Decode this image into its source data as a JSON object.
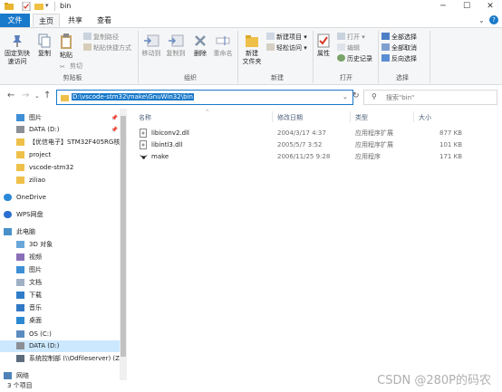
{
  "window": {
    "title": "bin"
  },
  "tabs": [
    "文件",
    "主页",
    "共享",
    "查看"
  ],
  "ribbon": {
    "clipboard": {
      "label": "剪贴板",
      "pin": "固定到快\n速访问",
      "copy": "复制",
      "paste": "粘贴",
      "copy_path": "复制路径",
      "paste_shortcut": "粘贴快捷方式",
      "cut": "剪切"
    },
    "organize": {
      "label": "组织",
      "move_to": "移动到",
      "copy_to": "复制到",
      "delete": "删除",
      "rename": "重命名"
    },
    "new": {
      "label": "新建",
      "new_folder": "新建\n文件夹",
      "new_item": "新建项目",
      "easy_access": "轻松访问"
    },
    "open": {
      "label": "打开",
      "properties": "属性",
      "open": "打开",
      "edit": "编辑",
      "history": "历史记录"
    },
    "select": {
      "label": "选择",
      "select_all": "全部选择",
      "select_none": "全部取消",
      "invert": "反向选择"
    }
  },
  "address": {
    "path": "D:\\vscode-stm32\\make\\GnuWin32\\bin"
  },
  "search": {
    "placeholder": "搜索\"bin\""
  },
  "nav": {
    "items": [
      {
        "label": "图片",
        "icon": "pictures-icon",
        "pinned": true
      },
      {
        "label": "DATA (D:)",
        "icon": "drive-icon",
        "pinned": true
      },
      {
        "label": "【优信电子】STM32F405RG核",
        "icon": "folder-icon",
        "pinned": false
      },
      {
        "label": "project",
        "icon": "folder-icon",
        "pinned": false
      },
      {
        "label": "vscode-stm32",
        "icon": "folder-icon",
        "pinned": false
      },
      {
        "label": "ziliao",
        "icon": "folder-icon",
        "pinned": false
      },
      {
        "label": "OneDrive",
        "icon": "cloud-icon",
        "pinned": false
      },
      {
        "label": "WPS网盘",
        "icon": "wps-cloud-icon",
        "pinned": false
      },
      {
        "label": "此电脑",
        "icon": "computer-icon",
        "pinned": false
      },
      {
        "label": "3D 对象",
        "icon": "3d-objects-icon",
        "pinned": false
      },
      {
        "label": "视频",
        "icon": "videos-icon",
        "pinned": false
      },
      {
        "label": "图片",
        "icon": "pictures-icon",
        "pinned": false
      },
      {
        "label": "文档",
        "icon": "documents-icon",
        "pinned": false
      },
      {
        "label": "下载",
        "icon": "downloads-icon",
        "pinned": false
      },
      {
        "label": "音乐",
        "icon": "music-icon",
        "pinned": false
      },
      {
        "label": "桌面",
        "icon": "desktop-icon",
        "pinned": false
      },
      {
        "label": "OS (C:)",
        "icon": "windows-drive-icon",
        "pinned": false
      },
      {
        "label": "DATA (D:)",
        "icon": "drive-icon",
        "pinned": false
      },
      {
        "label": "系统控制部 (\\\\Odfileserver) (Z",
        "icon": "network-drive-icon",
        "pinned": false
      },
      {
        "label": "网络",
        "icon": "network-icon",
        "pinned": false
      }
    ]
  },
  "list": {
    "headers": {
      "name": "名称",
      "date": "修改日期",
      "type": "类型",
      "size": "大小"
    },
    "rows": [
      {
        "name": "libiconv2.dll",
        "date": "2004/3/17 4:37",
        "type": "应用程序扩展",
        "size": "877 KB",
        "icon": "dll-file-icon"
      },
      {
        "name": "libintl3.dll",
        "date": "2005/5/7 3:52",
        "type": "应用程序扩展",
        "size": "101 KB",
        "icon": "dll-file-icon"
      },
      {
        "name": "make",
        "date": "2006/11/25 9:28",
        "type": "应用程序",
        "size": "171 KB",
        "icon": "gnu-exe-icon"
      }
    ]
  },
  "status": {
    "count": "3 个项目"
  },
  "watermark": "CSDN @280P的码农"
}
